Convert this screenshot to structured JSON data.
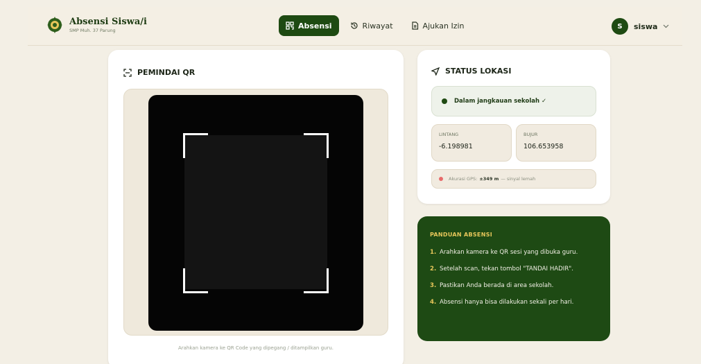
{
  "brand": {
    "title": "Absensi Siswa/i",
    "subtitle": "SMP Muh. 37 Parung"
  },
  "nav": {
    "items": [
      {
        "label": "Absensi"
      },
      {
        "label": "Riwayat"
      },
      {
        "label": "Ajukan Izin"
      }
    ]
  },
  "user": {
    "initial": "S",
    "name": "siswa"
  },
  "scanner": {
    "title": "PEMINDAI QR",
    "hint": "Arahkan kamera ke QR Code yang dipegang / ditampilkan guru."
  },
  "status": {
    "title": "STATUS LOKASI",
    "range_text": "Dalam jangkauan sekolah ✓",
    "latitude": {
      "label": "LINTANG",
      "value": "-6.198981"
    },
    "longitude": {
      "label": "BUJUR",
      "value": "106.653958"
    },
    "gps": {
      "prefix": "Akurasi GPS:",
      "value": "±349 m",
      "suffix": "— sinyal lemah"
    }
  },
  "guide": {
    "title": "PANDUAN ABSENSI",
    "items": [
      {
        "num": "1.",
        "text": "Arahkan kamera ke QR sesi yang dibuka guru."
      },
      {
        "num": "2.",
        "text": "Setelah scan, tekan tombol \"TANDAI HADIR\"."
      },
      {
        "num": "3.",
        "text": "Pastikan Anda berada di area sekolah."
      },
      {
        "num": "4.",
        "text": "Absensi hanya bisa dilakukan sekali per hari."
      }
    ]
  },
  "colors": {
    "primary": "#1e4a12",
    "accent": "#e6c65a",
    "background": "#f3efe5"
  }
}
